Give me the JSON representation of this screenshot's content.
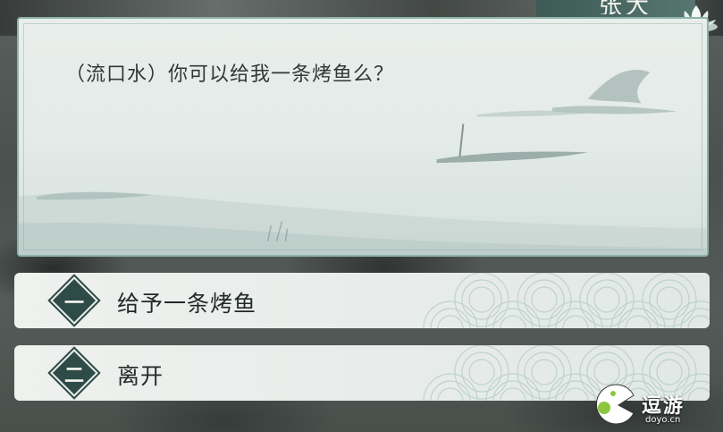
{
  "npc": {
    "name": "张大"
  },
  "dialog": {
    "line": "（流口水）你可以给我一条烤鱼么？"
  },
  "choices": [
    {
      "number": "一",
      "label": "给予一条烤鱼"
    },
    {
      "number": "二",
      "label": "离开"
    }
  ],
  "watermark": {
    "title": "逗游",
    "url": "doyo.cn"
  },
  "colors": {
    "panel_border": "#8fb2ab",
    "diamond": "#2e4b47",
    "name_plate": "#4d6c66"
  }
}
